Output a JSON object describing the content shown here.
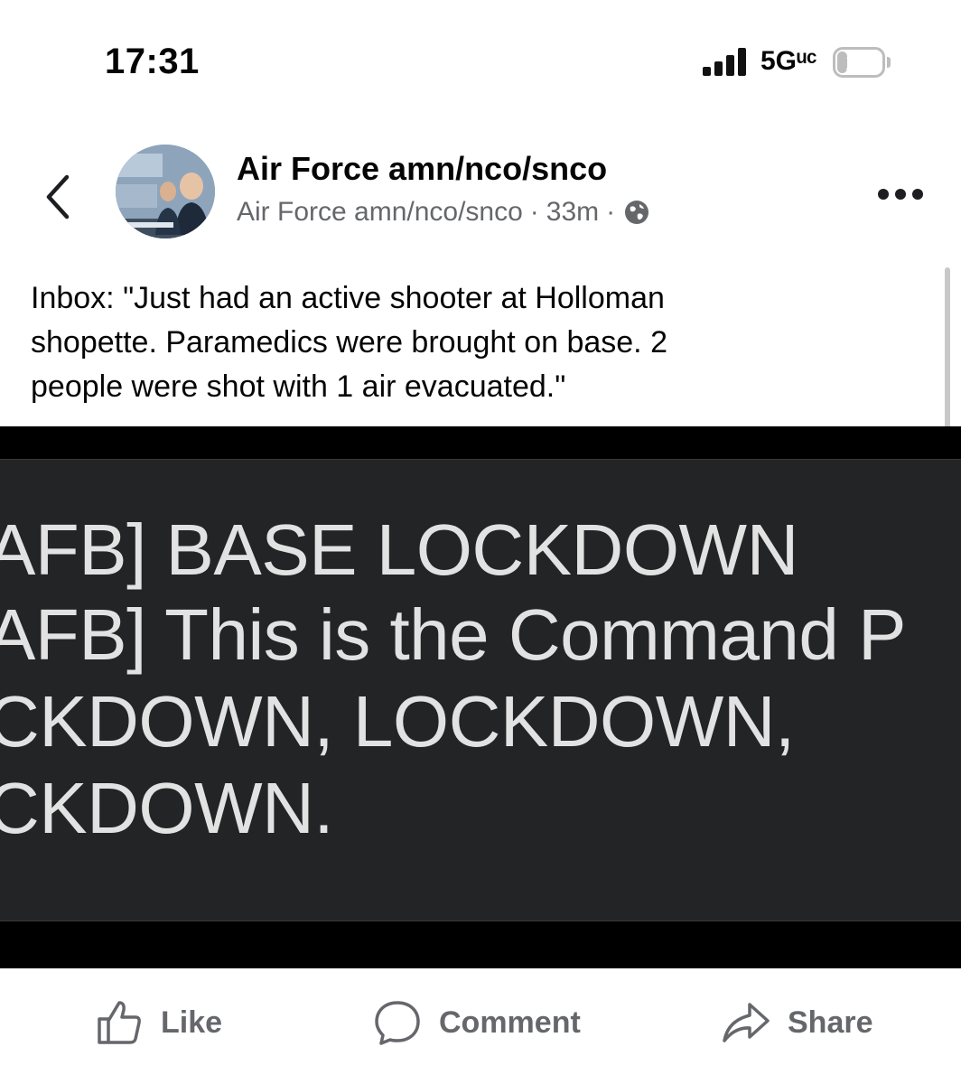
{
  "status_bar": {
    "time": "17:31",
    "network": "5Gᵘᶜ",
    "battery": "22",
    "battery_level_percent": 22
  },
  "post": {
    "page_name": "Air Force amn/nco/snco",
    "meta": {
      "author": "Air Force amn/nco/snco",
      "separator": "·",
      "time": "33m",
      "visibility_icon": "globe-icon"
    },
    "text_lines": [
      "Inbox: \"Just had an active shooter at Holloman",
      "shopette. Paramedics were brought on base. 2",
      "people were shot with 1 air evacuated.\""
    ],
    "image": {
      "lines": [
        "AFB] BASE LOCKDOWN",
        "AFB] This is the Command P",
        "CKDOWN, LOCKDOWN,",
        "CKDOWN."
      ]
    }
  },
  "actions": {
    "like": "Like",
    "comment": "Comment",
    "share": "Share"
  },
  "icons": {
    "back": "chevron-left-icon",
    "more": "more-dots-icon",
    "like": "thumbs-up-icon",
    "comment": "comment-bubble-icon",
    "share": "share-arrow-icon"
  },
  "colors": {
    "secondary_text": "#65676b",
    "image_background": "#232425",
    "image_text": "#e2e2e2"
  }
}
